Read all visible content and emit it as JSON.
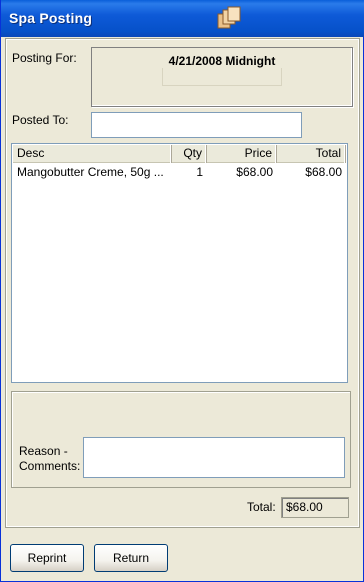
{
  "window": {
    "title": "Spa Posting"
  },
  "posting": {
    "posting_for_label": "Posting For:",
    "posting_for_value": "4/21/2008 Midnight",
    "posted_to_label": "Posted To:",
    "posted_to_value": ""
  },
  "table": {
    "columns": [
      "Desc",
      "Qty",
      "Price",
      "Total"
    ],
    "rows": [
      {
        "desc": "Mangobutter Creme, 50g ...",
        "qty": "1",
        "price": "$68.00",
        "total": "$68.00"
      }
    ]
  },
  "reason": {
    "label_line1": "Reason -",
    "label_line2": "Comments:",
    "value": ""
  },
  "summary": {
    "total_label": "Total:",
    "total_value": "$68.00"
  },
  "buttons": {
    "reprint": "Reprint",
    "return": "Return"
  },
  "colors": {
    "titlebar": "#0A5FD9",
    "window_bg": "#ECE9D8"
  }
}
